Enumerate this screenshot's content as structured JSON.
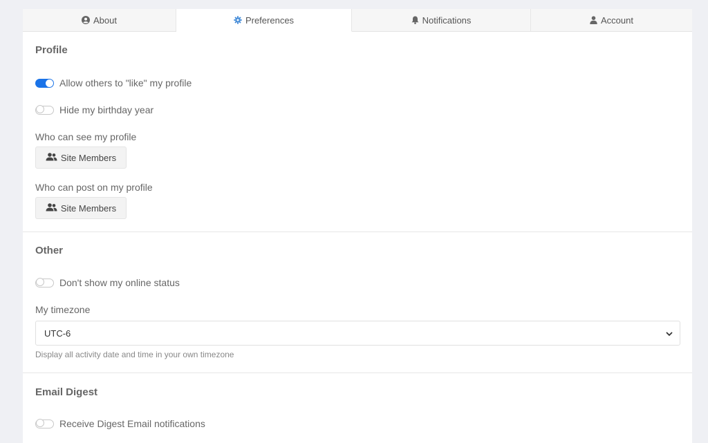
{
  "tabs": [
    {
      "label": "About",
      "icon": "user-circle-icon"
    },
    {
      "label": "Preferences",
      "icon": "gear-icon"
    },
    {
      "label": "Notifications",
      "icon": "bell-icon"
    },
    {
      "label": "Account",
      "icon": "user-icon"
    }
  ],
  "active_tab": "Preferences",
  "profile": {
    "heading": "Profile",
    "allow_like": {
      "label": "Allow others to \"like\" my profile",
      "enabled": true
    },
    "hide_birthday": {
      "label": "Hide my birthday year",
      "enabled": false
    },
    "who_see_label": "Who can see my profile",
    "who_see_value": "Site Members",
    "who_post_label": "Who can post on my profile",
    "who_post_value": "Site Members"
  },
  "other": {
    "heading": "Other",
    "hide_online": {
      "label": "Don't show my online status",
      "enabled": false
    },
    "timezone_label": "My timezone",
    "timezone_value": "UTC-6",
    "timezone_help": "Display all activity date and time in your own timezone"
  },
  "email_digest": {
    "heading": "Email Digest",
    "receive": {
      "label": "Receive Digest Email notifications",
      "enabled": false
    }
  },
  "colors": {
    "accent": "#1a73e8",
    "background": "#eff0f4"
  }
}
